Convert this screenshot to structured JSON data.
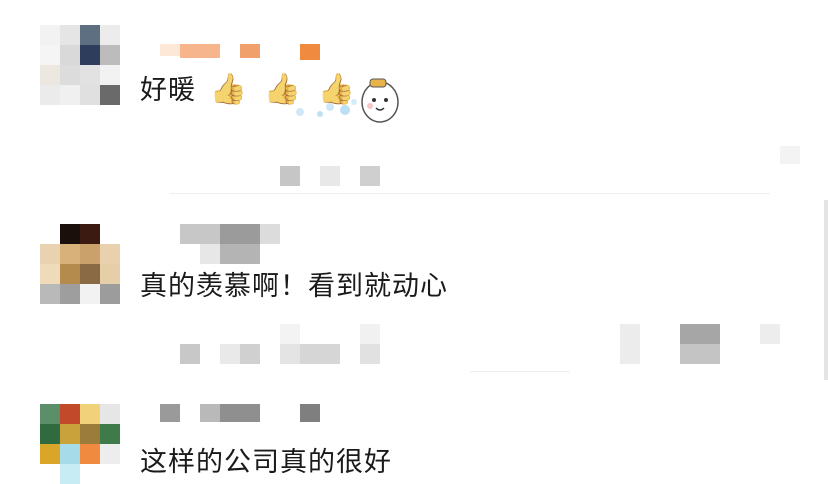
{
  "comments": [
    {
      "text": "好暖",
      "reaction_icons": [
        "thumbs-up-icon",
        "thumbs-up-icon",
        "thumbs-up-icon"
      ],
      "sticker": "cartoon-sticker",
      "thumb_glyph": "👍"
    },
    {
      "text": "真的羡慕啊！看到就动心"
    },
    {
      "text": "这样的公司真的很好"
    }
  ],
  "colors": {
    "text": "#1a1a1a",
    "blur_gray": "#c8c8c8",
    "accent_orange": "#f08a3e",
    "divider": "#eeeeee"
  }
}
